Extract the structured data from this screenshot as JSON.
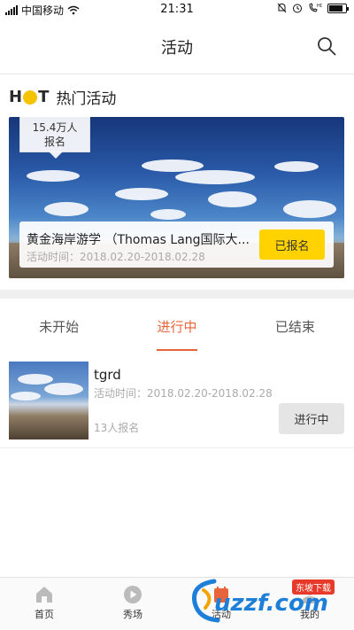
{
  "status_bar": {
    "carrier": "中国移动",
    "time": "21:31"
  },
  "header": {
    "title": "活动",
    "search_icon": "search-icon"
  },
  "hot": {
    "logo_h": "H",
    "logo_t": "T",
    "title": "热门活动",
    "banner": {
      "count_line1": "15.4万人",
      "count_line2": "报名",
      "title": "黄金海岸游学 （Thomas Lang国际大...",
      "time_label": "活动时间：2018.02.20-2018.02.28",
      "button_label": "已报名"
    }
  },
  "tabs": [
    {
      "label": "未开始",
      "active": false
    },
    {
      "label": "进行中",
      "active": true
    },
    {
      "label": "已结束",
      "active": false
    }
  ],
  "list": [
    {
      "title": "tgrd",
      "time_label": "活动时间：2018.02.20-2018.02.28",
      "count": "13人报名",
      "status_label": "进行中"
    }
  ],
  "bottom_nav": [
    {
      "label": "首页",
      "icon": "home-icon"
    },
    {
      "label": "秀场",
      "icon": "play-icon"
    },
    {
      "label": "活动",
      "icon": "activity-icon"
    },
    {
      "label": "我的",
      "icon": "profile-icon"
    }
  ],
  "watermark": {
    "text": "uzzf.com",
    "badge": "东坡下载"
  },
  "colors": {
    "accent": "#e8643a",
    "button_yellow": "#ffd200",
    "hot_dot": "#f6c300"
  }
}
